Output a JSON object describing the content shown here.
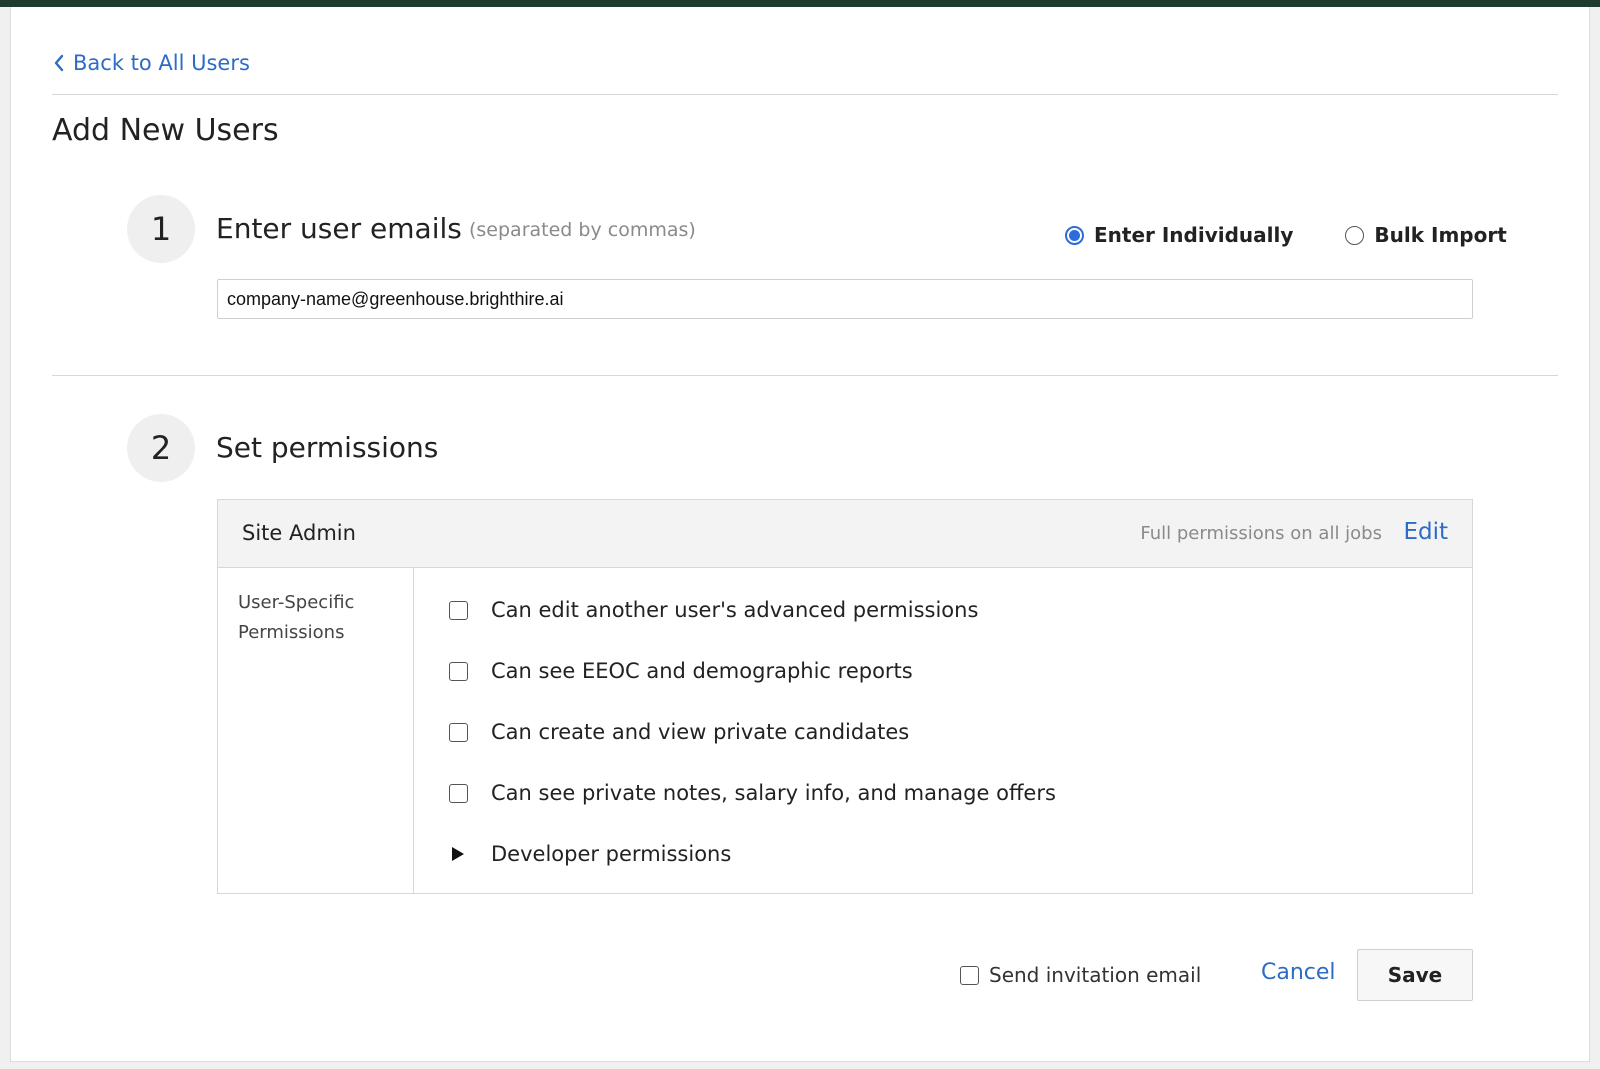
{
  "nav": {
    "back_label": "Back to All Users",
    "back_icon": "chevron-left-icon"
  },
  "page": {
    "title": "Add New Users"
  },
  "step1": {
    "number": "1",
    "heading": "Enter user emails",
    "hint": "(separated by commas)",
    "mode_options": [
      {
        "label": "Enter Individually",
        "selected": true
      },
      {
        "label": "Bulk Import",
        "selected": false
      }
    ],
    "email_value": "company-name@greenhouse.brighthire.ai"
  },
  "step2": {
    "number": "2",
    "heading": "Set permissions",
    "role": {
      "name": "Site Admin",
      "description": "Full permissions on all jobs",
      "edit_label": "Edit"
    },
    "user_specific_label": "User-Specific Permissions",
    "permissions": [
      {
        "label": "Can edit another user's advanced permissions",
        "checked": false
      },
      {
        "label": "Can see EEOC and demographic reports",
        "checked": false
      },
      {
        "label": "Can create and view private candidates",
        "checked": false
      },
      {
        "label": "Can see private notes, salary info, and manage offers",
        "checked": false
      }
    ],
    "developer_permissions_label": "Developer permissions"
  },
  "footer": {
    "invite_label": "Send invitation email",
    "invite_checked": false,
    "cancel_label": "Cancel",
    "save_label": "Save"
  },
  "colors": {
    "link": "#2e6bc6",
    "radio_accent": "#2e6bdb",
    "top_bar": "#1e3b2e"
  }
}
